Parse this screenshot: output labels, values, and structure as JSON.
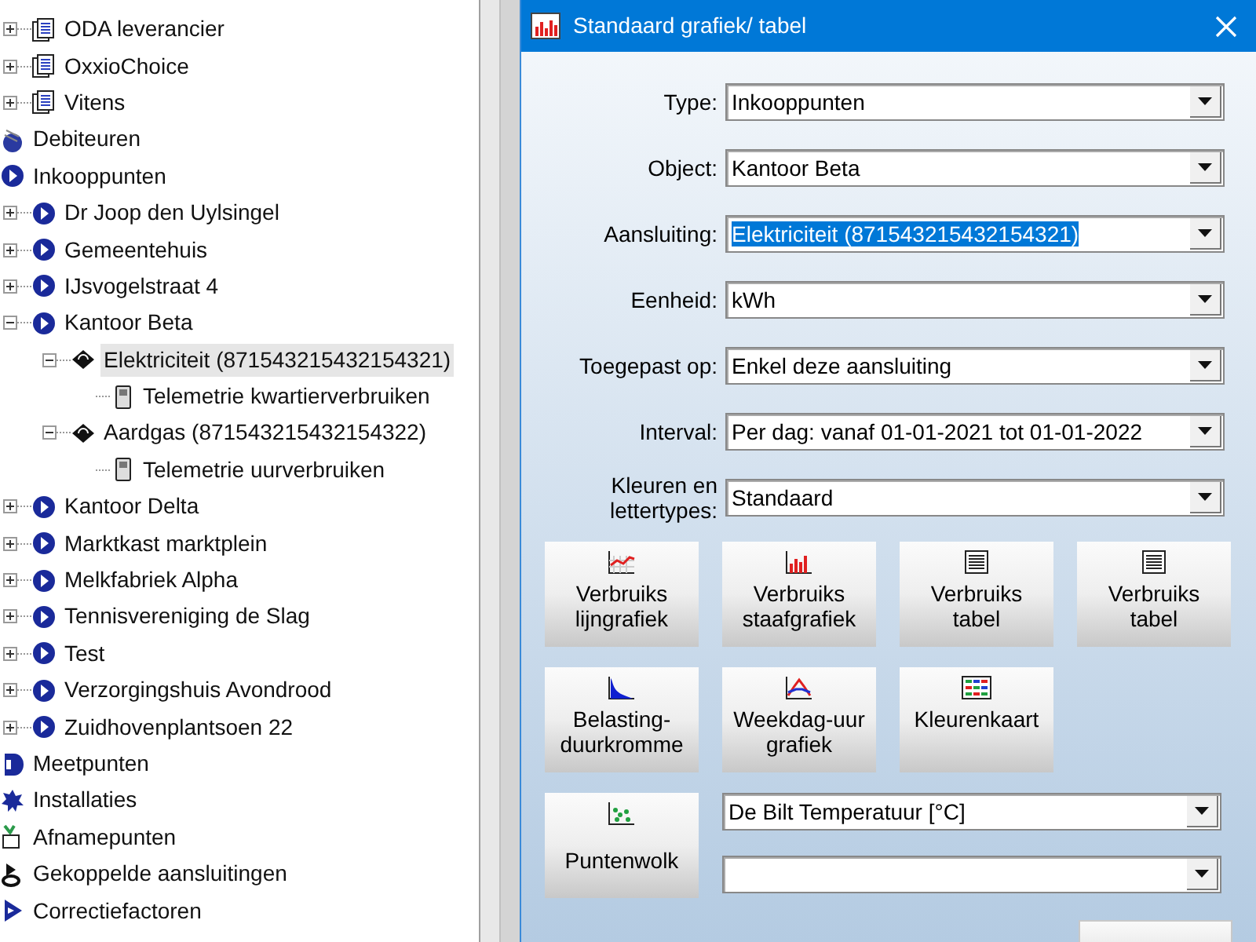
{
  "tree": [
    {
      "children": [
        {
          "label": "ODA leverancier",
          "kind": "document",
          "expanded": false
        },
        {
          "label": "OxxioChoice",
          "kind": "document",
          "expanded": false
        },
        {
          "label": "Vitens",
          "kind": "document",
          "expanded": false
        }
      ]
    },
    {
      "label": "Debiteuren",
      "kind": "debtor"
    },
    {
      "label": "Inkooppunten",
      "kind": "purchase",
      "children": [
        {
          "label": "Dr Joop den Uylsingel",
          "kind": "point",
          "expanded": false
        },
        {
          "label": "Gemeentehuis",
          "kind": "point",
          "expanded": false
        },
        {
          "label": "IJsvogelstraat 4",
          "kind": "point",
          "expanded": false
        },
        {
          "label": "Kantoor Beta",
          "kind": "point",
          "expanded": true,
          "children": [
            {
              "label": "Elektriciteit (871543215432154321)",
              "kind": "connection",
              "expanded": true,
              "selected": true,
              "children": [
                {
                  "label": "Telemetrie kwartierverbruiken",
                  "kind": "meter"
                }
              ]
            },
            {
              "label": "Aardgas (871543215432154322)",
              "kind": "connection",
              "expanded": true,
              "selected": false,
              "children": [
                {
                  "label": "Telemetrie uurverbruiken",
                  "kind": "meter"
                }
              ]
            }
          ]
        },
        {
          "label": "Kantoor Delta",
          "kind": "point",
          "expanded": false
        },
        {
          "label": "Marktkast marktplein",
          "kind": "point",
          "expanded": false
        },
        {
          "label": "Melkfabriek Alpha",
          "kind": "point",
          "expanded": false
        },
        {
          "label": "Tennisvereniging de Slag",
          "kind": "point",
          "expanded": false
        },
        {
          "label": "Test",
          "kind": "point",
          "expanded": false
        },
        {
          "label": "Verzorgingshuis Avondrood",
          "kind": "point",
          "expanded": false
        },
        {
          "label": "Zuidhovenplantsoen 22",
          "kind": "point",
          "expanded": false
        }
      ]
    },
    {
      "label": "Meetpunten",
      "kind": "measure"
    },
    {
      "label": "Installaties",
      "kind": "installation"
    },
    {
      "label": "Afnamepunten",
      "kind": "withdrawal"
    },
    {
      "label": "Gekoppelde aansluitingen",
      "kind": "linked"
    },
    {
      "label": "Correctiefactoren",
      "kind": "correction"
    }
  ],
  "dialog": {
    "title": "Standaard grafiek/ tabel",
    "fields": [
      {
        "label": "Type:",
        "value": "Inkooppunten",
        "highlighted": false
      },
      {
        "label": "Object:",
        "value": "Kantoor Beta",
        "highlighted": false
      },
      {
        "label": "Aansluiting:",
        "value": "Elektriciteit (871543215432154321)",
        "highlighted": true
      },
      {
        "label": "Eenheid:",
        "value": "kWh",
        "highlighted": false
      },
      {
        "label": "Toegepast op:",
        "value": "Enkel deze aansluiting",
        "highlighted": false
      },
      {
        "label": "Interval:",
        "value": "Per dag: vanaf 01-01-2021 tot 01-01-2022",
        "highlighted": false
      },
      {
        "label": "Kleuren en lettertypes:",
        "value": "Standaard",
        "highlighted": false
      }
    ],
    "buttons": [
      {
        "label": "Verbruiks lijngrafiek",
        "kind": "line"
      },
      {
        "label": "Verbruiks staafgrafiek",
        "kind": "bar"
      },
      {
        "label": "Verbruiks tabel",
        "kind": "table"
      },
      {
        "label": "Verbruiks tabel",
        "kind": "table"
      },
      {
        "label": "Belasting-duurkromme",
        "kind": "duration"
      },
      {
        "label": "Weekdag-uur grafiek",
        "kind": "weekday"
      },
      {
        "label": "Kleurenkaart",
        "kind": "heatmap"
      }
    ],
    "scatter_button": {
      "label": "Puntenwolk"
    },
    "scatter_fields": [
      {
        "value": "De Bilt Temperatuur [°C]",
        "highlighted": false
      },
      {
        "highlighted": false
      }
    ]
  }
}
